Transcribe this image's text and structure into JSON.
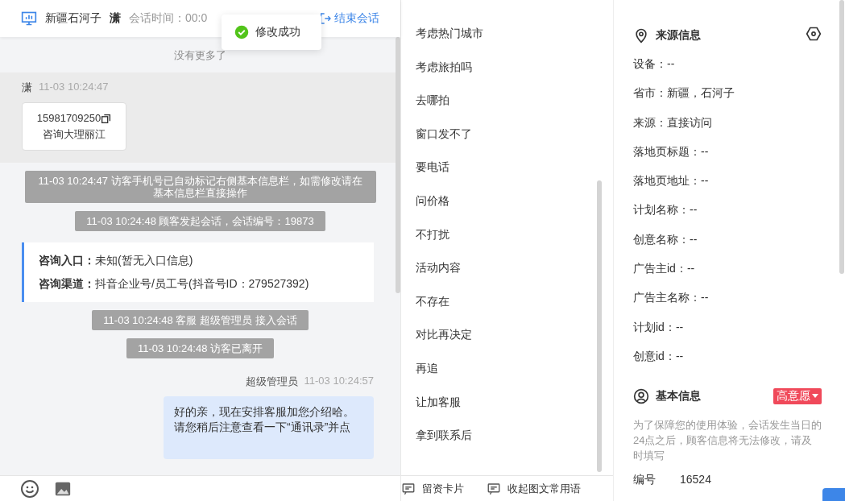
{
  "header": {
    "location": "新疆石河子",
    "visitor": "潇",
    "session_time": "会话时间：00:0",
    "end_button": "结束会话"
  },
  "toast": {
    "text": "修改成功"
  },
  "chat": {
    "no_more": "没有更多了",
    "messages": [
      {
        "kind": "visitor",
        "sender": "潇",
        "time": "11-03 10:24:47",
        "phone": "15981709250",
        "text": "咨询大理丽江"
      },
      {
        "kind": "system",
        "text": "11-03 10:24:47 访客手机号已自动标记右侧基本信息栏，如需修改请在基本信息栏直接操作"
      },
      {
        "kind": "system",
        "text": "11-03 10:24:48 顾客发起会话，会话编号：19873"
      },
      {
        "kind": "entry",
        "rows": [
          {
            "label": "咨询入口：",
            "value": "未知(暂无入口信息)"
          },
          {
            "label": "咨询渠道：",
            "value": "抖音企业号/员工号(抖音号ID：279527392)"
          }
        ]
      },
      {
        "kind": "system",
        "text": "11-03 10:24:48 客服 超级管理员 接入会话"
      },
      {
        "kind": "system",
        "text": "11-03 10:24:48 访客已离开"
      },
      {
        "kind": "agent",
        "sender": "超级管理员",
        "time": "11-03 10:24:57",
        "text": "好的亲，现在安排客服加您介绍哈。请您稍后注意查看一下“通讯录”并点"
      }
    ]
  },
  "quick_replies": [
    "考虑热门城市",
    "考虑旅拍吗",
    "去哪拍",
    "窗口发不了",
    "要电话",
    "问价格",
    "不打扰",
    "活动内容",
    "不存在",
    "对比再决定",
    "再追",
    "让加客服",
    "拿到联系后"
  ],
  "toolbar": {
    "actions": [
      "留资卡片",
      "收起图文常用语"
    ]
  },
  "source_info": {
    "title": "来源信息",
    "fields": [
      "设备：--",
      "省市：新疆，石河子",
      "来源：直接访问",
      "落地页标题：--",
      "落地页地址：--",
      "计划名称：--",
      "创意名称：--",
      "广告主id：--",
      "广告主名称：--",
      "计划id：--",
      "创意id：--"
    ]
  },
  "basic_info": {
    "title": "基本信息",
    "intent": "高意愿",
    "notice": "为了保障您的使用体验，会话发生当日的24点之后，顾客信息将无法修改，请及时填写",
    "fields": [
      {
        "label": "编号",
        "value": "16524"
      }
    ]
  }
}
